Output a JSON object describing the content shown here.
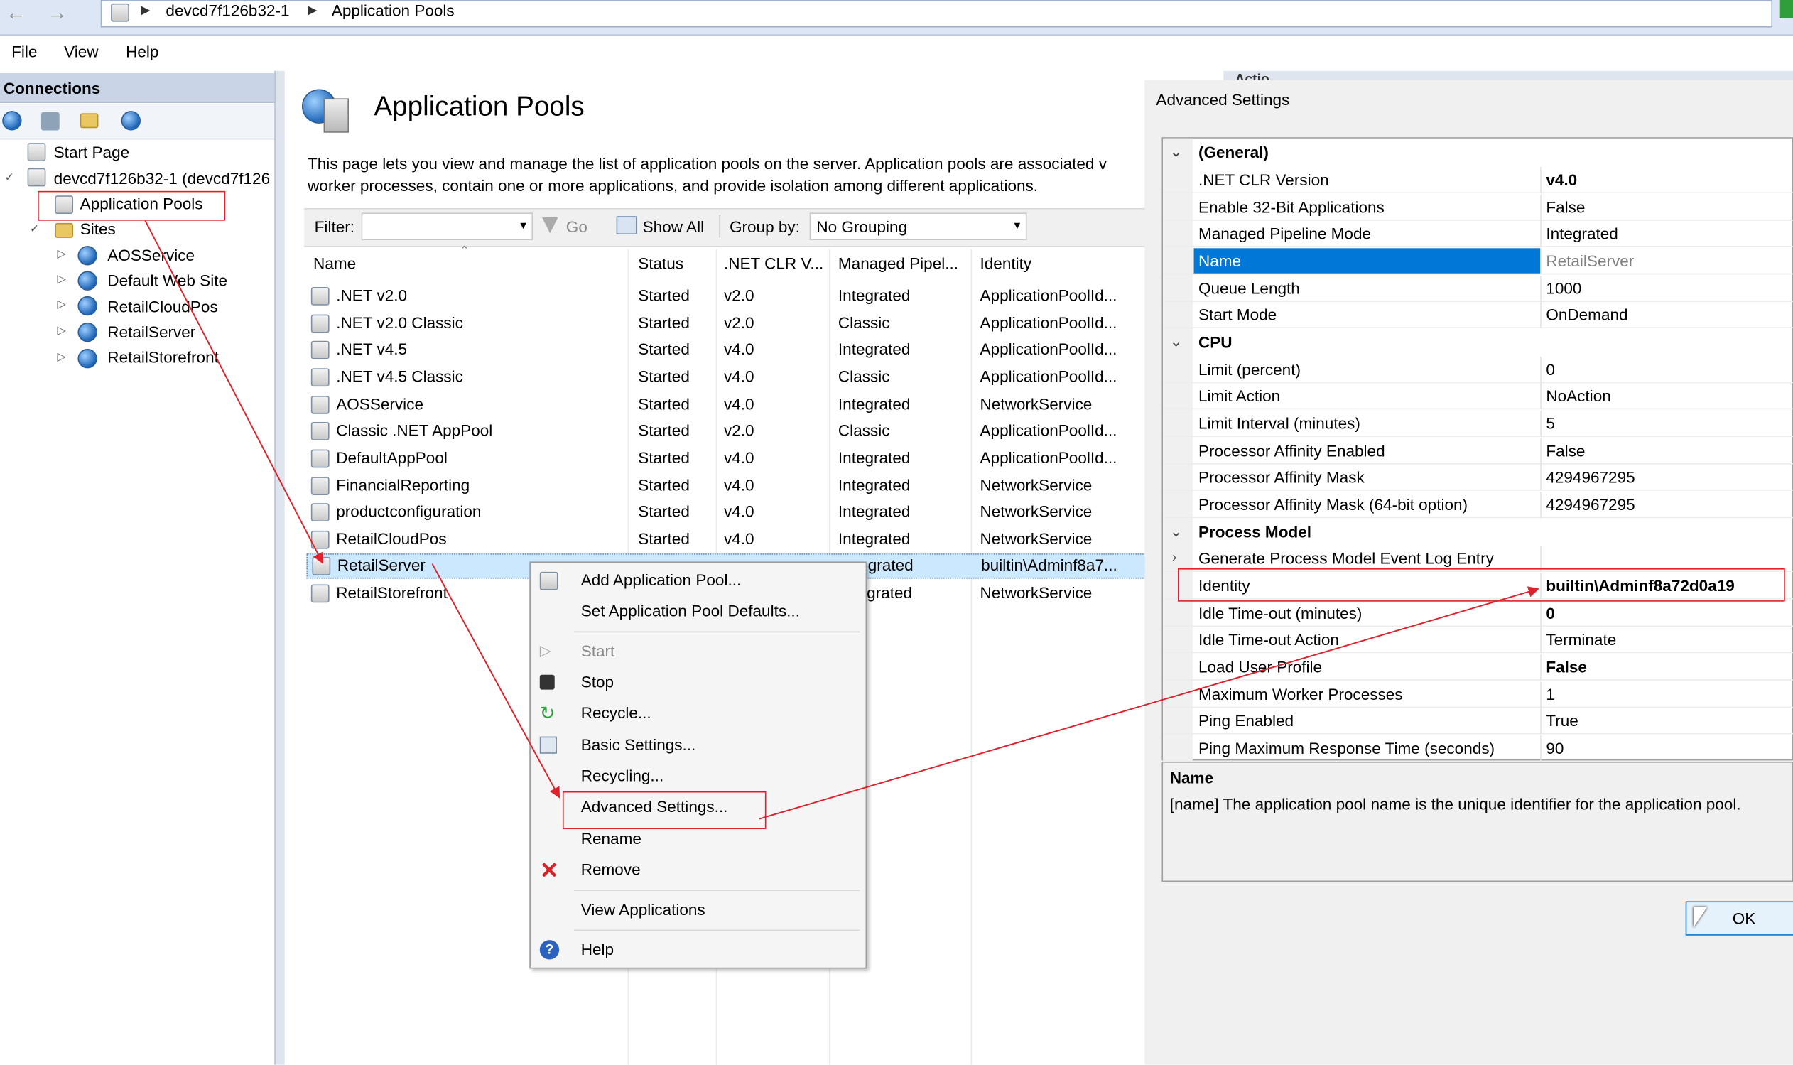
{
  "address": {
    "segments": [
      "devcd7f126b32-1",
      "Application Pools"
    ]
  },
  "menubar": {
    "items": [
      "File",
      "View",
      "Help"
    ]
  },
  "connections": {
    "title": "Connections",
    "tree": {
      "start_page": "Start Page",
      "server": "devcd7f126b32-1 (devcd7f126",
      "app_pools": "Application Pools",
      "sites": "Sites",
      "site_items": [
        "AOSService",
        "Default Web Site",
        "RetailCloudPos",
        "RetailServer",
        "RetailStorefront"
      ]
    }
  },
  "main": {
    "title": "Application Pools",
    "description_line1": "This page lets you view and manage the list of application pools on the server. Application pools are associated v",
    "description_line2": "worker processes, contain one or more applications, and provide isolation among different applications.",
    "filter_label": "Filter:",
    "go_label": "Go",
    "show_all_label": "Show All",
    "group_by_label": "Group by:",
    "group_by_value": "No Grouping",
    "columns": [
      "Name",
      "Status",
      ".NET CLR V...",
      "Managed Pipel...",
      "Identity"
    ],
    "rows": [
      {
        "name": ".NET v2.0",
        "status": "Started",
        "clr": "v2.0",
        "pipeline": "Integrated",
        "identity": "ApplicationPoolId..."
      },
      {
        "name": ".NET v2.0 Classic",
        "status": "Started",
        "clr": "v2.0",
        "pipeline": "Classic",
        "identity": "ApplicationPoolId..."
      },
      {
        "name": ".NET v4.5",
        "status": "Started",
        "clr": "v4.0",
        "pipeline": "Integrated",
        "identity": "ApplicationPoolId..."
      },
      {
        "name": ".NET v4.5 Classic",
        "status": "Started",
        "clr": "v4.0",
        "pipeline": "Classic",
        "identity": "ApplicationPoolId..."
      },
      {
        "name": "AOSService",
        "status": "Started",
        "clr": "v4.0",
        "pipeline": "Integrated",
        "identity": "NetworkService"
      },
      {
        "name": "Classic .NET AppPool",
        "status": "Started",
        "clr": "v2.0",
        "pipeline": "Classic",
        "identity": "ApplicationPoolId..."
      },
      {
        "name": "DefaultAppPool",
        "status": "Started",
        "clr": "v4.0",
        "pipeline": "Integrated",
        "identity": "ApplicationPoolId..."
      },
      {
        "name": "FinancialReporting",
        "status": "Started",
        "clr": "v4.0",
        "pipeline": "Integrated",
        "identity": "NetworkService"
      },
      {
        "name": "productconfiguration",
        "status": "Started",
        "clr": "v4.0",
        "pipeline": "Integrated",
        "identity": "NetworkService"
      },
      {
        "name": "RetailCloudPos",
        "status": "Started",
        "clr": "v4.0",
        "pipeline": "Integrated",
        "identity": "NetworkService"
      },
      {
        "name": "RetailServer",
        "status": "",
        "clr": "",
        "pipeline": "grated",
        "identity": "builtin\\Adminf8a7..."
      },
      {
        "name": "RetailStorefront",
        "status": "",
        "clr": "",
        "pipeline": "grated",
        "identity": "NetworkService"
      }
    ]
  },
  "context_menu": {
    "add_pool": "Add Application Pool...",
    "set_defaults": "Set Application Pool Defaults...",
    "start": "Start",
    "stop": "Stop",
    "recycle": "Recycle...",
    "basic_settings": "Basic Settings...",
    "recycling": "Recycling...",
    "advanced_settings": "Advanced Settings...",
    "rename": "Rename",
    "remove": "Remove",
    "view_applications": "View Applications",
    "help": "Help"
  },
  "advanced_settings": {
    "title": "Advanced Settings",
    "sections": [
      {
        "name": "(General)",
        "props": [
          {
            "key": ".NET CLR Version",
            "value": "v4.0",
            "bold": true
          },
          {
            "key": "Enable 32-Bit Applications",
            "value": "False"
          },
          {
            "key": "Managed Pipeline Mode",
            "value": "Integrated"
          },
          {
            "key": "Name",
            "value": "RetailServer",
            "selected": true
          },
          {
            "key": "Queue Length",
            "value": "1000"
          },
          {
            "key": "Start Mode",
            "value": "OnDemand"
          }
        ]
      },
      {
        "name": "CPU",
        "props": [
          {
            "key": "Limit (percent)",
            "value": "0"
          },
          {
            "key": "Limit Action",
            "value": "NoAction"
          },
          {
            "key": "Limit Interval (minutes)",
            "value": "5"
          },
          {
            "key": "Processor Affinity Enabled",
            "value": "False"
          },
          {
            "key": "Processor Affinity Mask",
            "value": "4294967295"
          },
          {
            "key": "Processor Affinity Mask (64-bit option)",
            "value": "4294967295"
          }
        ]
      },
      {
        "name": "Process Model",
        "props": [
          {
            "key": "Generate Process Model Event Log Entry",
            "value": "",
            "expandable": true
          },
          {
            "key": "Identity",
            "value": "builtin\\Adminf8a72d0a19",
            "bold": true
          },
          {
            "key": "Idle Time-out (minutes)",
            "value": "0",
            "bold": true
          },
          {
            "key": "Idle Time-out Action",
            "value": "Terminate"
          },
          {
            "key": "Load User Profile",
            "value": "False",
            "bold": true
          },
          {
            "key": "Maximum Worker Processes",
            "value": "1"
          },
          {
            "key": "Ping Enabled",
            "value": "True"
          },
          {
            "key": "Ping Maximum Response Time (seconds)",
            "value": "90"
          }
        ]
      }
    ],
    "desc_title": "Name",
    "desc_text": "[name] The application pool name is the unique identifier for the application pool.",
    "ok_label": "OK",
    "right_panel_fragment": "Actio"
  },
  "colors": {
    "accent": "#0078d7",
    "annotation": "#e0202a",
    "selection": "#cce8ff"
  }
}
